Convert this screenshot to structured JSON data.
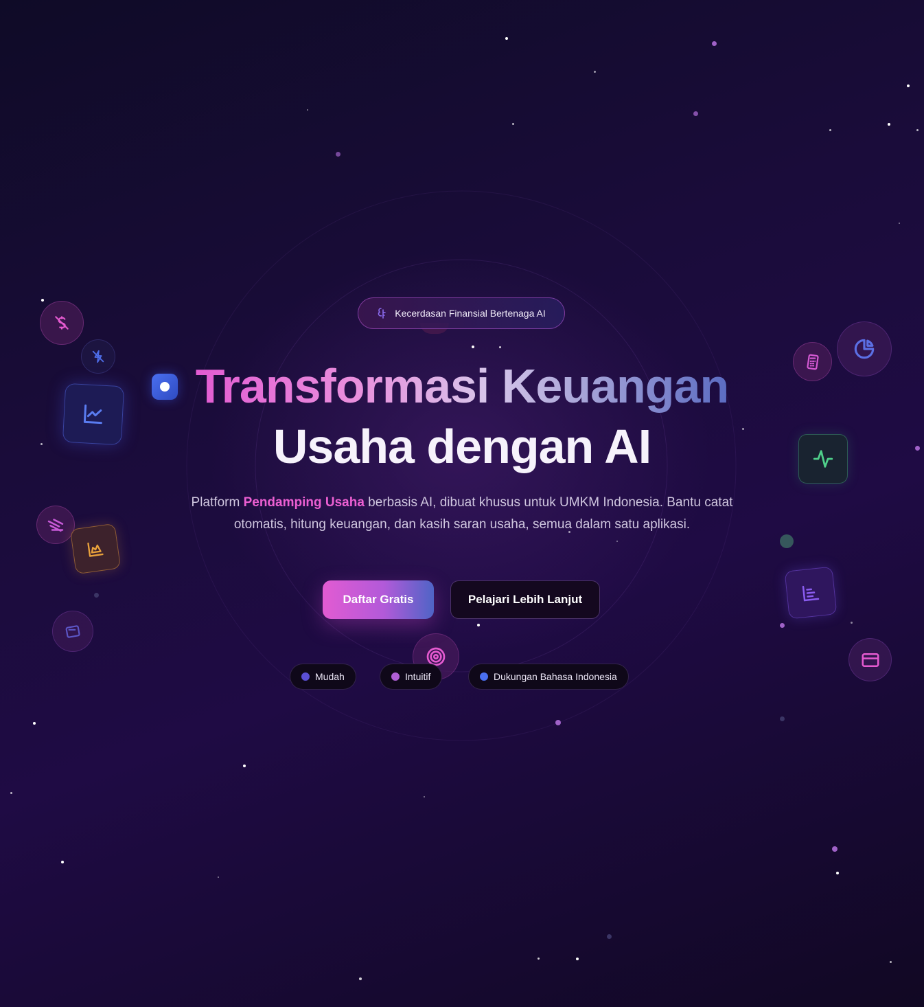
{
  "badge": {
    "text": "Kecerdasan Finansial Bertenaga AI",
    "icon": "ai-brain-icon"
  },
  "hero": {
    "title_line1": "Transformasi Keuangan",
    "title_line2": "Usaha dengan AI"
  },
  "description": {
    "part1": "Platform ",
    "highlight": "Pendamping Usaha",
    "part2": " berbasis AI, dibuat khusus untuk UMKM Indonesia. Bantu catat otomatis, hitung keuangan, dan kasih saran usaha, semua dalam satu aplikasi."
  },
  "buttons": {
    "primary": "Daftar Gratis",
    "secondary": "Pelajari Lebih Lanjut"
  },
  "features": [
    {
      "label": "Mudah",
      "color": "#5b4fd6"
    },
    {
      "label": "Intuitif",
      "color": "#b05fd6"
    },
    {
      "label": "Dukungan Bahasa Indonesia",
      "color": "#4a6ff0"
    }
  ],
  "colors": {
    "accent_pink": "#e25bd2",
    "accent_blue": "#4a6ff0",
    "background": "#1a0c3a"
  },
  "floating_icons": [
    "dollar-off-icon",
    "bolt-off-icon",
    "line-chart-icon",
    "receipt-icon",
    "crown-chart-icon",
    "wallet-icon",
    "calculator-icon",
    "pie-chart-icon",
    "activity-icon",
    "bar-list-icon",
    "credit-card-icon",
    "target-icon"
  ]
}
